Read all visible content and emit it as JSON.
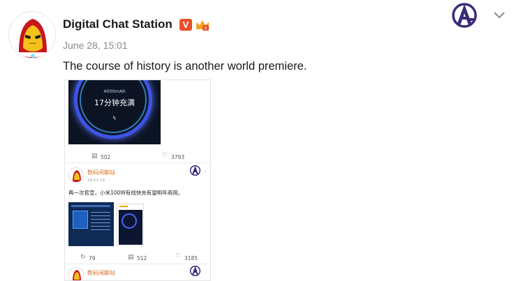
{
  "post": {
    "username": "Digital Chat Station",
    "verified_badge": "V",
    "level_badge_icon": "level-crown-badge-icon",
    "timestamp": "June 28, 15:01",
    "text": "The course of history is another world premiere.",
    "header_icons": {
      "theme": "avengers-logo-icon",
      "menu": "chevron-down-icon"
    }
  },
  "embedded_screenshot": {
    "promo": {
      "capacity": "4000mAh",
      "charge_text": "17分钟充满",
      "bolt": "ϟ"
    },
    "first_post_stats": {
      "comments": "502",
      "likes": "3793"
    },
    "repost": {
      "author": "数码闲聊站",
      "time": "19-11-19",
      "text": "再一次官宣，小米100W有线快充有望明年商用。",
      "stats": {
        "reposts": "79",
        "comments": "512",
        "likes": "3185"
      }
    },
    "next_post": {
      "author": "数码闲聊站"
    }
  },
  "colors": {
    "brand_orange": "#e8502a",
    "name_orange": "#e07020",
    "avengers_purple": "#3b2a7a"
  }
}
